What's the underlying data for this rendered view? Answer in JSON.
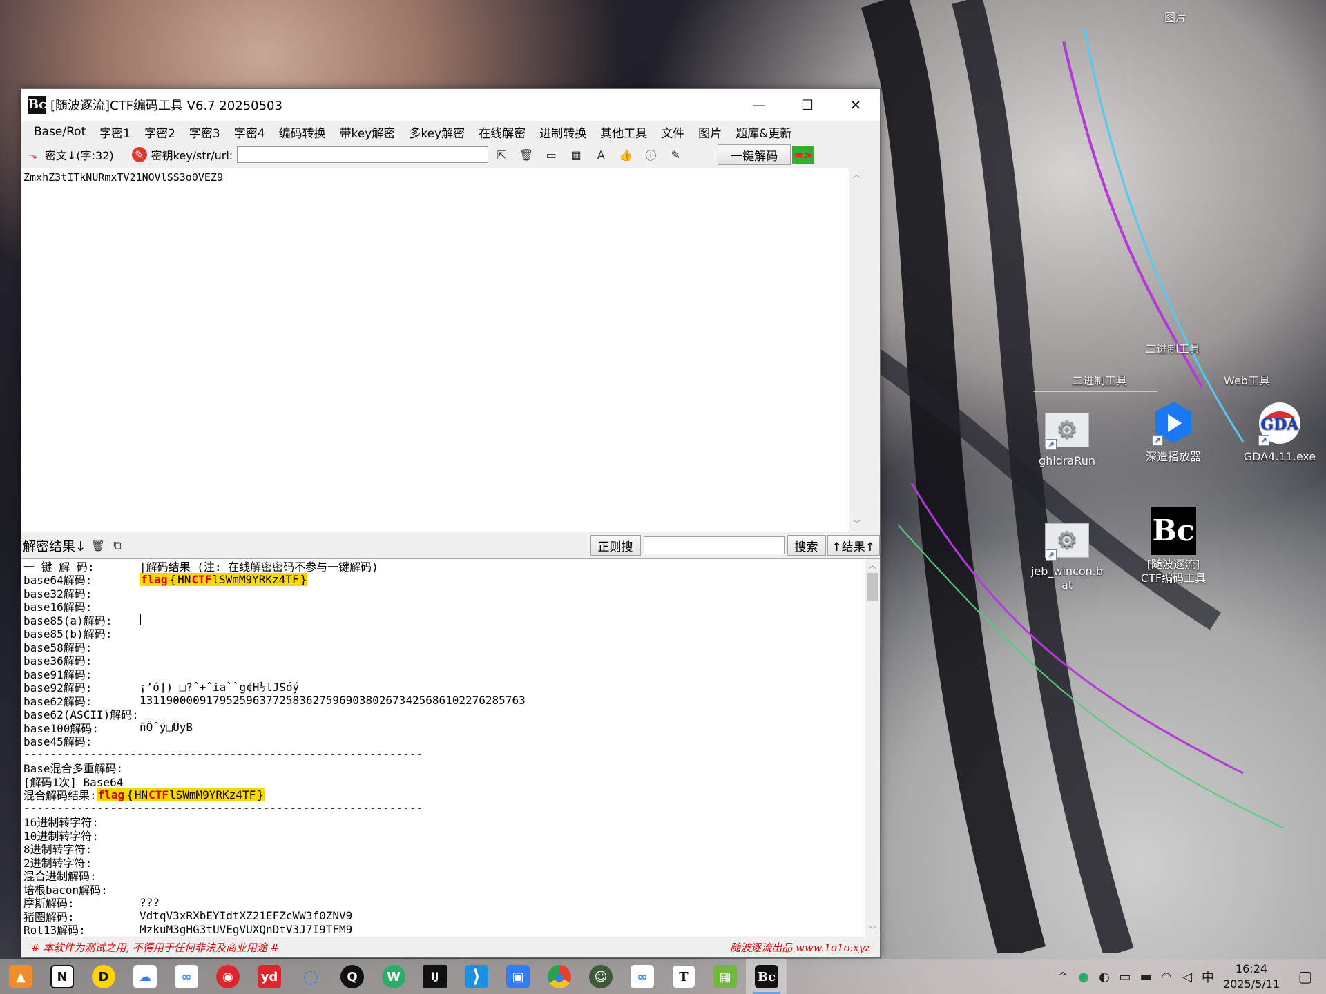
{
  "desktop": {
    "labels": {
      "pictures": "图片",
      "binary_tools_top": "二进制工具",
      "binary_tools": "二进制工具",
      "web_tools": "Web工具"
    },
    "icons": [
      {
        "label": "ghidraRun",
        "icon": "gear-icon"
      },
      {
        "label": "深造播放器",
        "icon": "player-icon"
      },
      {
        "label": "GDA4.11.exe",
        "icon": "gda-icon"
      },
      {
        "label": "jeb_wincon.b\nat",
        "icon": "gear-icon"
      },
      {
        "label": "[随波逐流]\nCTF编码工具",
        "icon": "bc-logo-icon"
      }
    ]
  },
  "window": {
    "title": "[随波逐流]CTF编码工具 V6.7  20250503",
    "logo_text": "Bc",
    "controls": {
      "minimize": "—",
      "maximize": "☐",
      "close": "✕"
    },
    "menu": [
      "Base/Rot",
      "字密1",
      "字密2",
      "字密3",
      "字密4",
      "编码转换",
      "带key解密",
      "多key解密",
      "在线解密",
      "进制转换",
      "其他工具",
      "文件",
      "图片",
      "题库&更新"
    ],
    "toolbar": {
      "cipher_label": "密文↓(字:32)",
      "key_label": "密钥key/str/url:",
      "key_value": "",
      "one_click": "一键解码",
      "arrow": "=>"
    },
    "cipher_text": "ZmxhZ3tITkNURmxTV21NOVlSS3o0VEZ9",
    "result_bar": {
      "label": "解密结果↓",
      "regex_button": "正则搜",
      "search_value": "",
      "search_button": "搜索",
      "result_up_button": "↑结果↑"
    },
    "results": {
      "header_label": "一 键 解 码:",
      "header_value": "|解码结果 (注: 在线解密密码不参与一键解码)",
      "base_rows": [
        {
          "label": "base64解码:",
          "value": ""
        },
        {
          "label": "base32解码:",
          "value": ""
        },
        {
          "label": "base16解码:",
          "value": ""
        },
        {
          "label": "base85(a)解码:",
          "value": ""
        },
        {
          "label": "base85(b)解码:",
          "value": ""
        },
        {
          "label": "base58解码:",
          "value": ""
        },
        {
          "label": "base36解码:",
          "value": ""
        },
        {
          "label": "base91解码:",
          "value": ""
        },
        {
          "label": "base92解码:",
          "value": "¡’ó]) □?ˆ+ˆia``g¢H½lJSóý"
        },
        {
          "label": "base62解码:",
          "value": "13119000091795259637725836275969038026734256861022762857​63"
        },
        {
          "label": "base62(ASCII)解码:",
          "value": ""
        },
        {
          "label": "base100解码:",
          "value": "ñÖˆÿ□ÜyB"
        },
        {
          "label": "base45解码:",
          "value": ""
        }
      ],
      "flag_parts": {
        "flag": "flag",
        "lbrace": "{",
        "hn": "HN",
        "ctf": "CTF",
        "rest": "lSWmM9YRKz4TF",
        "rbrace": "}"
      },
      "separator": "------------------------------------------------------------",
      "mix_title": "Base混合多重解码:",
      "mix_count": "[解码1次] Base64",
      "mix_result_label": "混合解码结果:",
      "other_rows": [
        {
          "label": "16进制转字符:",
          "value": ""
        },
        {
          "label": "10进制转字符:",
          "value": ""
        },
        {
          "label": "8进制转字符:",
          "value": ""
        },
        {
          "label": "2进制转字符:",
          "value": ""
        },
        {
          "label": "混合进制解码:",
          "value": ""
        },
        {
          "label": "培根bacon解码:",
          "value": ""
        },
        {
          "label": "摩斯解码:",
          "value": "???"
        },
        {
          "label": "猪圈解码:",
          "value": "VdtqV3xRXbEYIdtXZ21EFZcWW3f0ZNV9"
        },
        {
          "label": "Rot13解码:",
          "value": "MzkuM3gHG3tUVEgVUXQnDtV3J7I9TFM9"
        }
      ]
    },
    "status": {
      "left": "# 本软件为测试之用, 不得用于任何非法及商业用途 #",
      "right": "随波逐流出品 www.1o1o.xyz"
    }
  },
  "taskbar": {
    "apps": [
      {
        "name": "files-app-icon",
        "glyph": "▲",
        "color": "#f28c28"
      },
      {
        "name": "notion-icon",
        "glyph": "N",
        "color": "#ffffff"
      },
      {
        "name": "pocket-icon",
        "glyph": "D",
        "color": "#ffd400"
      },
      {
        "name": "cloud-drive-icon",
        "glyph": "☁",
        "color": "#2f7df6"
      },
      {
        "name": "baidu-netdisk-icon",
        "glyph": "∞",
        "color": "#3d8bff"
      },
      {
        "name": "netease-music-icon",
        "glyph": "◉",
        "color": "#e0242b"
      },
      {
        "name": "youdao-icon",
        "glyph": "yd",
        "color": "#e0242b"
      },
      {
        "name": "search-app-icon",
        "glyph": "◌",
        "color": "#2f7df6"
      },
      {
        "name": "qq-icon",
        "glyph": "Q",
        "color": "#111111"
      },
      {
        "name": "wechat-icon",
        "glyph": "W",
        "color": "#2aae67"
      },
      {
        "name": "jetbrains-icon",
        "glyph": "IJ",
        "color": "#111111"
      },
      {
        "name": "vscode-icon",
        "glyph": "⟩",
        "color": "#1f8fe0"
      },
      {
        "name": "window-app-icon",
        "glyph": "▣",
        "color": "#2f7df6"
      },
      {
        "name": "chrome-icon",
        "glyph": "●",
        "color": "#e3412f"
      },
      {
        "name": "avatar-app-icon",
        "glyph": "☺",
        "color": "#3e5a3a"
      },
      {
        "name": "netdisk2-icon",
        "glyph": "∞",
        "color": "#3d8bff"
      },
      {
        "name": "typora-icon",
        "glyph": "T",
        "color": "#ffffff"
      },
      {
        "name": "image-app-icon",
        "glyph": "▦",
        "color": "#6fb83b"
      },
      {
        "name": "ctf-tool-icon",
        "glyph": "Bc",
        "color": "#111111"
      }
    ],
    "tray": {
      "chevron": "^",
      "ime": "中",
      "time": "16:24",
      "date": "2025/5/11"
    }
  }
}
